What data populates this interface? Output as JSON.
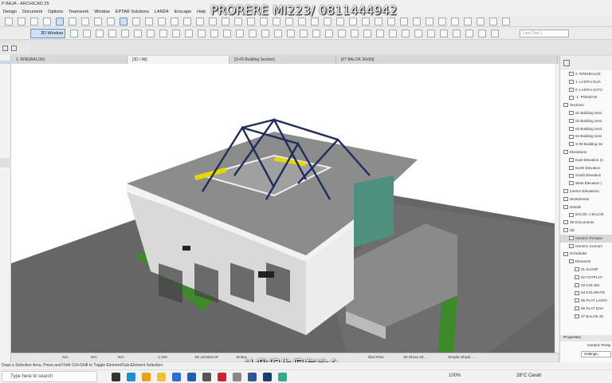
{
  "titlebar": {
    "title": "P BAJA - ARCHICAD 25"
  },
  "menu": [
    "Design",
    "Document",
    "Options",
    "Teamwork",
    "Window",
    "EPTAR Solutions",
    "LAND4",
    "Enscape",
    "Help"
  ],
  "overlay": {
    "watermark": "PRORERE MI223/ 0811444942"
  },
  "toolbar": {
    "window_3d_label": "3D Window",
    "layer_combo_placeholder": "Last One 1"
  },
  "tabs": [
    {
      "label": "1. RINGBALOK)",
      "active": false
    },
    {
      "label": "[3D / All]",
      "active": true
    },
    {
      "label": "[S-09 Building Section]",
      "active": false
    },
    {
      "label": "[07 BALOK 30x50]",
      "active": false
    }
  ],
  "navigator": {
    "items": [
      {
        "label": "2. RINGBALOK",
        "indent": 1
      },
      {
        "label": "1. LANTAI DUA",
        "indent": 1
      },
      {
        "label": "0. LANTAI SATU",
        "indent": 1
      },
      {
        "label": "-1. PONDASI",
        "indent": 1
      },
      {
        "label": "Sections",
        "indent": 0
      },
      {
        "label": "01 Building Sect",
        "indent": 1
      },
      {
        "label": "02 Building Sect",
        "indent": 1
      },
      {
        "label": "03 Building Sect",
        "indent": 1
      },
      {
        "label": "04 Building Sect",
        "indent": 1
      },
      {
        "label": "S-09 Building Se",
        "indent": 1
      },
      {
        "label": "Elevations",
        "indent": 0
      },
      {
        "label": "East Elevation (A",
        "indent": 1
      },
      {
        "label": "North Elevation",
        "indent": 1
      },
      {
        "label": "South Elevation",
        "indent": 1
      },
      {
        "label": "West Elevation (",
        "indent": 1
      },
      {
        "label": "Interior Elevations",
        "indent": 0
      },
      {
        "label": "Worksheets",
        "indent": 0
      },
      {
        "label": "Details",
        "indent": 0
      },
      {
        "label": "BALOK 1 BALOK",
        "indent": 1
      },
      {
        "label": "3D Documents",
        "indent": 0
      },
      {
        "label": "3D",
        "indent": 0
      },
      {
        "label": "Generic Perspec",
        "indent": 1,
        "selected": true
      },
      {
        "label": "Generic Axonom",
        "indent": 1
      },
      {
        "label": "Schedules",
        "indent": 0
      },
      {
        "label": "Elements",
        "indent": 1
      },
      {
        "label": "01 SLOOF",
        "indent": 2
      },
      {
        "label": "02 FOTPLAT",
        "indent": 2
      },
      {
        "label": "03 KOLOM",
        "indent": 2
      },
      {
        "label": "04 KOLOM PE",
        "indent": 2
      },
      {
        "label": "05 PLAT LANTA",
        "indent": 2
      },
      {
        "label": "06 PLAT DAK",
        "indent": 2
      },
      {
        "label": "07 BALOK 30",
        "indent": 2
      }
    ]
  },
  "properties": {
    "header": "Properties",
    "value": "Generic Persp",
    "settings": "Settings..."
  },
  "statusbar": {
    "items": [
      "N/A",
      "N/A",
      "N/A",
      "1:100",
      "3D LENGKAP",
      "Entire"
    ],
    "right_items": [
      "ified Plan",
      "30 Show All ...",
      "Simple Shadi..."
    ]
  },
  "hint": "Draw a Selection Area. Press and Hold Ctrl+Shift to Toggle Element/Sub-Element Selection.",
  "taskbar": {
    "search_placeholder": "Type here to search",
    "zoom": "100%",
    "weather": "28°C  Cerah",
    "icons": [
      {
        "name": "task-view-icon",
        "color": "#333"
      },
      {
        "name": "edge-icon",
        "color": "#1a8fd8"
      },
      {
        "name": "chrome-icon",
        "color": "#e8a21c"
      },
      {
        "name": "file-explorer-icon",
        "color": "#f2c233"
      },
      {
        "name": "mail-icon",
        "color": "#2b6fd0"
      },
      {
        "name": "archicad-icon",
        "color": "#1d5fb4"
      },
      {
        "name": "store-icon",
        "color": "#555"
      },
      {
        "name": "media-icon",
        "color": "#c23"
      },
      {
        "name": "settings-icon",
        "color": "#888"
      },
      {
        "name": "word-icon",
        "color": "#2b579a"
      },
      {
        "name": "photoshop-icon",
        "color": "#1b3b6f"
      },
      {
        "name": "app-icon",
        "color": "#3a8"
      }
    ]
  },
  "subtitle": "让我们先保存这个"
}
